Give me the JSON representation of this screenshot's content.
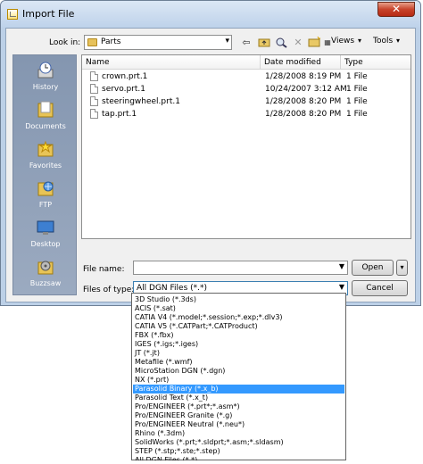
{
  "window": {
    "title": "Import File",
    "close_glyph": "✕"
  },
  "lookin": {
    "label": "Look in:",
    "value": "Parts"
  },
  "toolbar": {
    "views_label": "Views",
    "tools_label": "Tools"
  },
  "places": [
    {
      "label": "History",
      "icon": "history-icon"
    },
    {
      "label": "Documents",
      "icon": "documents-icon"
    },
    {
      "label": "Favorites",
      "icon": "favorites-icon"
    },
    {
      "label": "FTP",
      "icon": "ftp-icon"
    },
    {
      "label": "Desktop",
      "icon": "desktop-icon"
    },
    {
      "label": "Buzzsaw",
      "icon": "buzzsaw-icon"
    }
  ],
  "filelist": {
    "columns": [
      "Name",
      "Date modified",
      "Type"
    ],
    "rows": [
      {
        "name": "crown.prt.1",
        "date": "1/28/2008 8:19 PM",
        "type": "1 File"
      },
      {
        "name": "servo.prt.1",
        "date": "10/24/2007 3:12 AM",
        "type": "1 File"
      },
      {
        "name": "steeringwheel.prt.1",
        "date": "1/28/2008 8:20 PM",
        "type": "1 File"
      },
      {
        "name": "tap.prt.1",
        "date": "1/28/2008 8:20 PM",
        "type": "1 File"
      }
    ]
  },
  "filename": {
    "label": "File name:",
    "value": ""
  },
  "filetype": {
    "label": "Files of type:",
    "value": "All DGN Files (*.*)",
    "options": [
      "3D Studio (*.3ds)",
      "ACIS (*.sat)",
      "CATIA V4 (*.model;*.session;*.exp;*.dlv3)",
      "CATIA V5 (*.CATPart;*.CATProduct)",
      "FBX (*.fbx)",
      "IGES (*.igs;*.iges)",
      "JT (*.jt)",
      "Metafile (*.wmf)",
      "MicroStation DGN (*.dgn)",
      "NX (*.prt)",
      "Parasolid Binary (*.x_b)",
      "Parasolid Text (*.x_t)",
      "Pro/ENGINEER (*.prt*;*.asm*)",
      "Pro/ENGINEER Granite (*.g)",
      "Pro/ENGINEER Neutral (*.neu*)",
      "Rhino (*.3dm)",
      "SolidWorks (*.prt;*.sldprt;*.asm;*.sldasm)",
      "STEP (*.stp;*.ste;*.step)",
      "All DGN Files (*.*)"
    ],
    "selected_option": "Parasolid Binary (*.x_b)"
  },
  "buttons": {
    "open_label": "Open",
    "cancel_label": "Cancel"
  }
}
